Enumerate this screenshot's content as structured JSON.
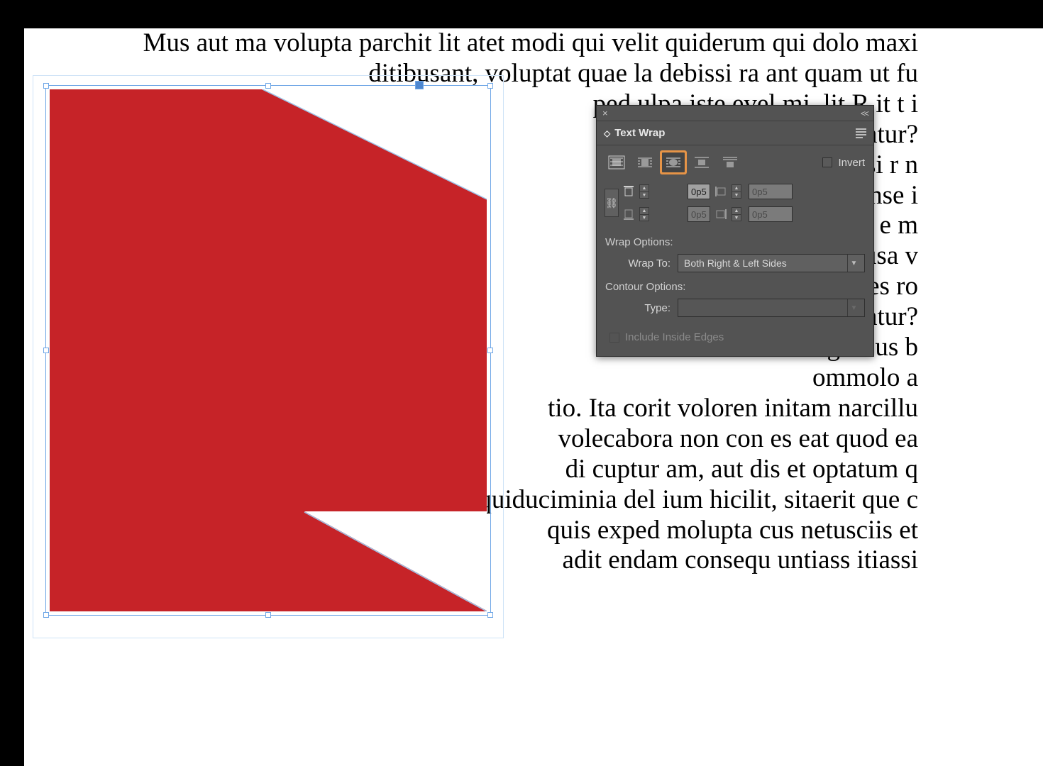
{
  "canvas": {
    "body_text": "Mus aut ma volupta parchit lit atet modi qui velit quiderum qui dolo maxi\nditibusant, voluptat quae la debissi ra ant quam ut fu\nped ulpa iste evel mi,   lit    R   it      t            i\nplatur?\nEquassi r                                                n\nae conse                                                 i\ntinctat e                                              m\nvelibusa                                                v\nsequaes                                                ro\nquatur?\nUgitibus                                                b\nommolo                                                 a\ntio. Ita corit voloren initam narcillu\nvolecabora non con es eat quod ea\ndi cuptur am, aut dis et optatum q\nquiduciminia del ium hicilit, sitaerit que c\nquis exped molupta cus netusciis et\nadit endam consequ untiass itiassi",
    "shape_fill": "#c62328"
  },
  "panel": {
    "title": "Text Wrap",
    "invert_label": "Invert",
    "offsets": {
      "top": "0p5",
      "bottom": "0p5",
      "left": "0p5",
      "right": "0p5"
    },
    "wrap_options_label": "Wrap Options:",
    "wrap_to_label": "Wrap To:",
    "wrap_to_value": "Both Right & Left Sides",
    "contour_options_label": "Contour Options:",
    "type_label": "Type:",
    "type_value": "",
    "include_inside_label": "Include Inside Edges"
  }
}
